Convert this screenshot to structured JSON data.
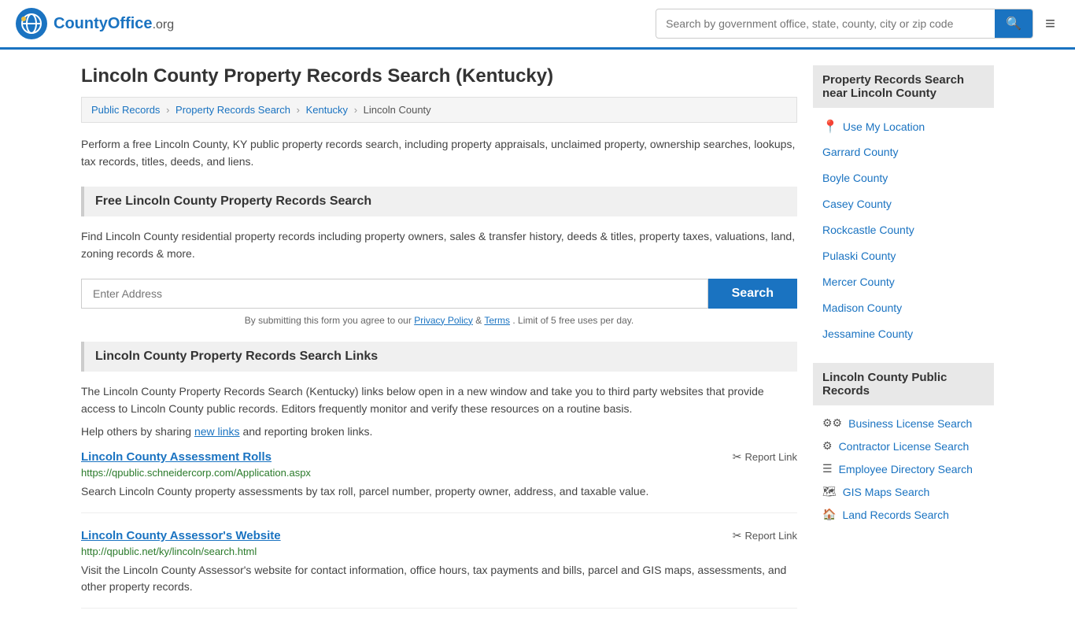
{
  "header": {
    "logo_text": "CountyOffice",
    "logo_suffix": ".org",
    "search_placeholder": "Search by government office, state, county, city or zip code",
    "menu_icon": "≡"
  },
  "page": {
    "title": "Lincoln County Property Records Search (Kentucky)",
    "breadcrumb": [
      {
        "label": "Public Records",
        "href": "#"
      },
      {
        "label": "Property Records Search",
        "href": "#"
      },
      {
        "label": "Kentucky",
        "href": "#"
      },
      {
        "label": "Lincoln County",
        "href": "#"
      }
    ],
    "description": "Perform a free Lincoln County, KY public property records search, including property appraisals, unclaimed property, ownership searches, lookups, tax records, titles, deeds, and liens.",
    "free_search_title": "Free Lincoln County Property Records Search",
    "free_search_desc": "Find Lincoln County residential property records including property owners, sales & transfer history, deeds & titles, property taxes, valuations, land, zoning records & more.",
    "address_placeholder": "Enter Address",
    "search_button": "Search",
    "disclaimer": "By submitting this form you agree to our",
    "privacy_label": "Privacy Policy",
    "terms_label": "Terms",
    "disclaimer_end": ". Limit of 5 free uses per day.",
    "links_title": "Lincoln County Property Records Search Links",
    "links_desc": "The Lincoln County Property Records Search (Kentucky) links below open in a new window and take you to third party websites that provide access to Lincoln County public records. Editors frequently monitor and verify these resources on a routine basis.",
    "share_text": "Help others by sharing",
    "new_links_label": "new links",
    "share_end": "and reporting broken links.",
    "links": [
      {
        "title": "Lincoln County Assessment Rolls",
        "url": "https://qpublic.schneidercorp.com/Application.aspx",
        "desc": "Search Lincoln County property assessments by tax roll, parcel number, property owner, address, and taxable value.",
        "report": "Report Link"
      },
      {
        "title": "Lincoln County Assessor's Website",
        "url": "http://qpublic.net/ky/lincoln/search.html",
        "desc": "Visit the Lincoln County Assessor's website for contact information, office hours, tax payments and bills, parcel and GIS maps, assessments, and other property records.",
        "report": "Report Link"
      }
    ]
  },
  "sidebar": {
    "nearby_title": "Property Records Search near Lincoln County",
    "use_my_location": "Use My Location",
    "nearby_links": [
      "Garrard County",
      "Boyle County",
      "Casey County",
      "Rockcastle County",
      "Pulaski County",
      "Mercer County",
      "Madison County",
      "Jessamine County"
    ],
    "public_records_title": "Lincoln County Public Records",
    "public_records_links": [
      {
        "icon": "⚙",
        "label": "Business License Search"
      },
      {
        "icon": "⚙",
        "label": "Contractor License Search"
      },
      {
        "icon": "☰",
        "label": "Employee Directory Search"
      },
      {
        "icon": "🗺",
        "label": "GIS Maps Search"
      },
      {
        "icon": "🏠",
        "label": "Land Records Search"
      }
    ]
  }
}
